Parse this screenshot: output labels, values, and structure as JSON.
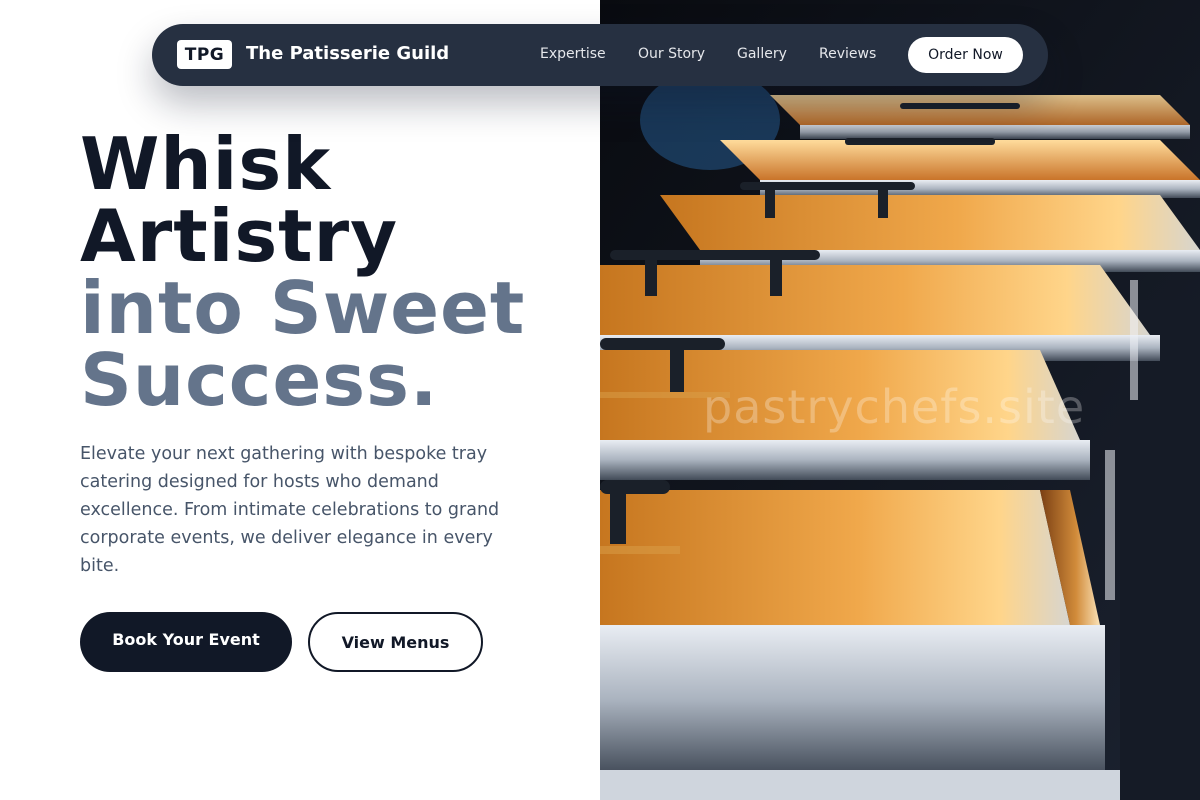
{
  "nav": {
    "logo_text": "TPG",
    "brand_name": "The Patisserie Guild",
    "links": [
      "Expertise",
      "Our Story",
      "Gallery",
      "Reviews"
    ],
    "cta_label": "Order Now"
  },
  "hero": {
    "headline_line1": "Whisk",
    "headline_line2": "Artistry",
    "headline_line3": "into Sweet",
    "headline_line4": "Success.",
    "description": "Elevate your next gathering with bespoke tray catering designed for hosts who demand excellence. From intimate celebrations to grand corporate events, we deliver elegance in every bite.",
    "primary_button": "Book Your Event",
    "secondary_button": "View Menus"
  },
  "image": {
    "watermark": "pastrychefs.site"
  },
  "colors": {
    "navbar_bg": "#263041",
    "headline_dark": "#111827",
    "headline_muted": "#64748b",
    "body_text": "#475569",
    "primary_button_bg": "#111827"
  }
}
